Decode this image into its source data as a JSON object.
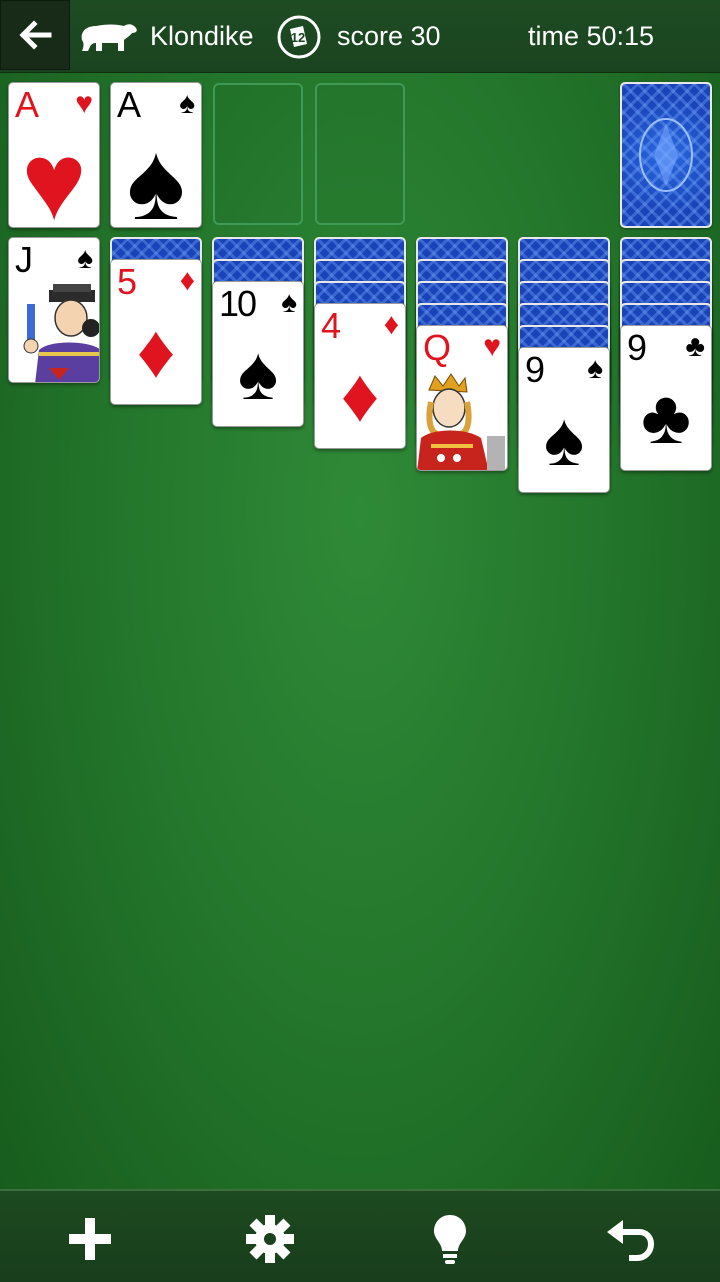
{
  "header": {
    "back_icon": "arrow-left-icon",
    "game_icon": "polar-bear-icon",
    "game_name": "Klondike",
    "score_icon": "card-badge-icon",
    "score_text": "score 30",
    "time_text": "time 50:15"
  },
  "foundations": [
    {
      "rank": "A",
      "suit": "♥",
      "color": "red"
    },
    {
      "rank": "A",
      "suit": "♠",
      "color": "black"
    },
    null,
    null
  ],
  "stock": {
    "face_down": true
  },
  "tableau": [
    {
      "hidden": 0,
      "top": {
        "rank": "J",
        "suit": "♠",
        "color": "black",
        "face": true
      }
    },
    {
      "hidden": 1,
      "top": {
        "rank": "5",
        "suit": "♦",
        "color": "red"
      }
    },
    {
      "hidden": 2,
      "top": {
        "rank": "10",
        "suit": "♠",
        "color": "black"
      }
    },
    {
      "hidden": 3,
      "top": {
        "rank": "4",
        "suit": "♦",
        "color": "red"
      }
    },
    {
      "hidden": 4,
      "top": {
        "rank": "Q",
        "suit": "♥",
        "color": "red",
        "face": true
      }
    },
    {
      "hidden": 5,
      "top": {
        "rank": "9",
        "suit": "♠",
        "color": "black"
      }
    },
    {
      "hidden": 4,
      "top": {
        "rank": "9",
        "suit": "♣",
        "color": "black"
      }
    }
  ],
  "toolbar": {
    "new_icon": "plus-icon",
    "settings_icon": "gear-icon",
    "hint_icon": "lightbulb-icon",
    "undo_icon": "undo-icon"
  },
  "colors": {
    "felt": "#24772c",
    "bar": "#1a4420",
    "card_back": "#1a43b8",
    "red_suit": "#e0141e"
  }
}
